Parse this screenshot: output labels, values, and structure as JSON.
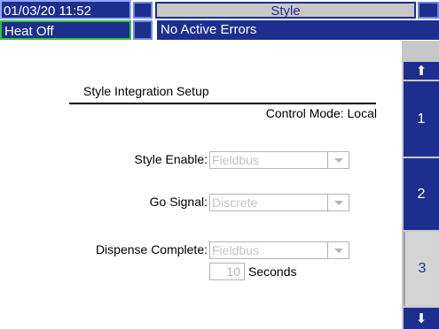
{
  "header": {
    "datetime": "01/03/20 11:52",
    "screen_title": "Style",
    "heat_status": "Heat Off",
    "error_status": "No Active Errors"
  },
  "sidebar": {
    "scroll_up_icon": "⬆",
    "tabs": [
      {
        "label": "1"
      },
      {
        "label": "2"
      },
      {
        "label": "3",
        "selected": true
      }
    ],
    "scroll_down_icon": "⬇"
  },
  "main": {
    "section_title": "Style Integration Setup",
    "control_mode": "Control Mode: Local",
    "style_enable": {
      "label": "Style Enable:",
      "value": "Fieldbus"
    },
    "go_signal": {
      "label": "Go Signal:",
      "value": "Discrete"
    },
    "dispense_complete": {
      "label": "Dispense Complete:",
      "value": "Fieldbus"
    },
    "timeout": {
      "value": "10",
      "unit": "Seconds"
    }
  },
  "colors": {
    "header_blue": "#1c2f8f",
    "selected_gray": "#c8c8c8",
    "heat_border_green": "#30c030",
    "disabled_text": "#c4c4c4"
  }
}
